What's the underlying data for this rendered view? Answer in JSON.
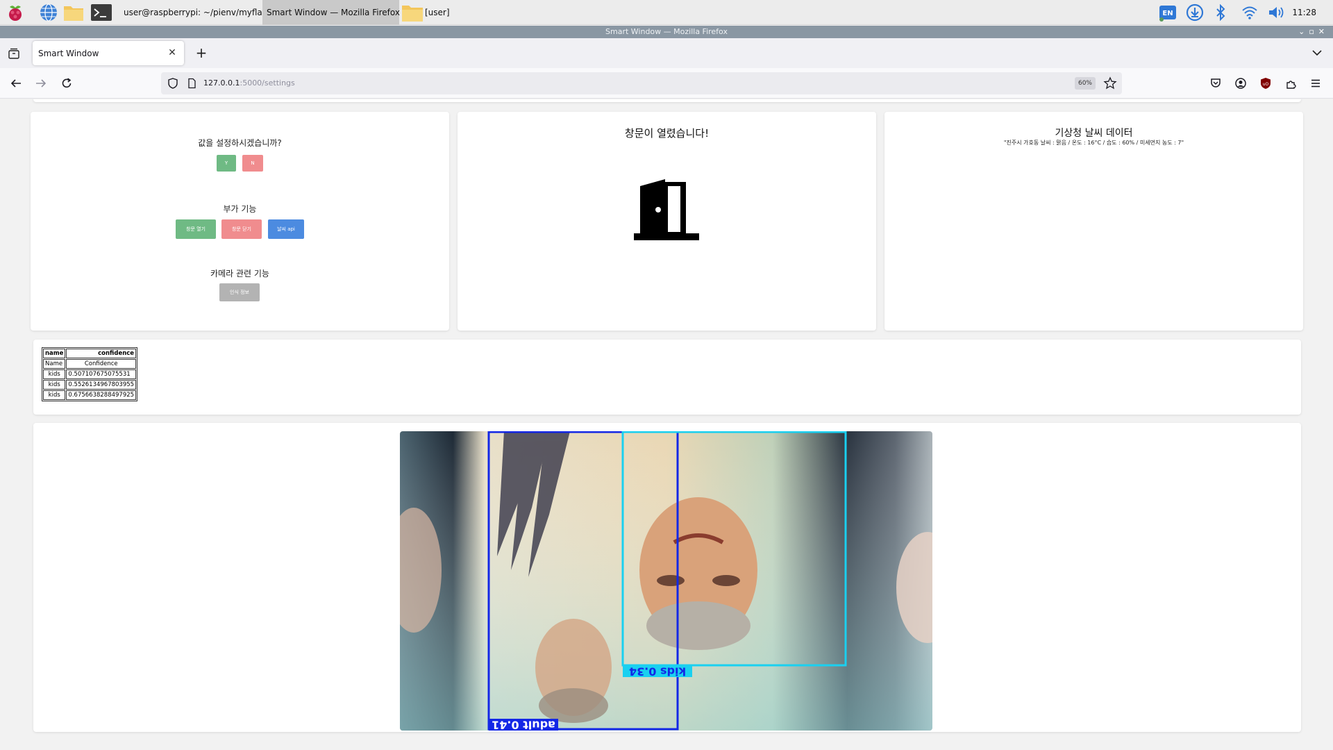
{
  "taskbar": {
    "terminal_task": "user@raspberrypi: ~/pienv/myfla…",
    "firefox_task": "Smart Window — Mozilla Firefox",
    "files_task": "[user]",
    "language": "EN",
    "clock": "11:28"
  },
  "window": {
    "title": "Smart Window — Mozilla Firefox"
  },
  "tab": {
    "label": "Smart Window"
  },
  "navbar": {
    "url_host": "127.0.0.1",
    "url_path": ":5000/settings",
    "zoom": "60%"
  },
  "settings_card": {
    "question": "값을 설정하시겠습니까?",
    "yes_label": "Y",
    "no_label": "N",
    "extra_heading": "부가 기능",
    "open_label": "창문 열기",
    "close_label": "창문 닫기",
    "weather_label": "날씨 api",
    "camera_heading": "카메라 관련 기능",
    "recognition_label": "인식 정보"
  },
  "door_card": {
    "title": "창문이 열렸습니다!"
  },
  "weather_card": {
    "title": "기상청 날씨 데이터",
    "text": "\"진주시 가호동 날씨 : 맑음 / 온도 : 16°C / 습도 : 60% / 미세먼지 농도 : 7\""
  },
  "predictions": {
    "headers": [
      "name",
      "confidence"
    ],
    "rows": [
      [
        "Name",
        "Confidence"
      ],
      [
        "kids",
        "0.507107675075531"
      ],
      [
        "kids",
        "0.5526134967803955"
      ],
      [
        "kids",
        "0.6756638288497925"
      ]
    ]
  },
  "detections": [
    {
      "label": "adult 0.41",
      "color": "#1327e6"
    },
    {
      "label": "kids 0.34",
      "color": "#1ad0f0"
    }
  ],
  "colors": {
    "green": "#6fba84",
    "red": "#f08c8e",
    "blue": "#4c8be0",
    "gray": "#b3b3b3"
  }
}
